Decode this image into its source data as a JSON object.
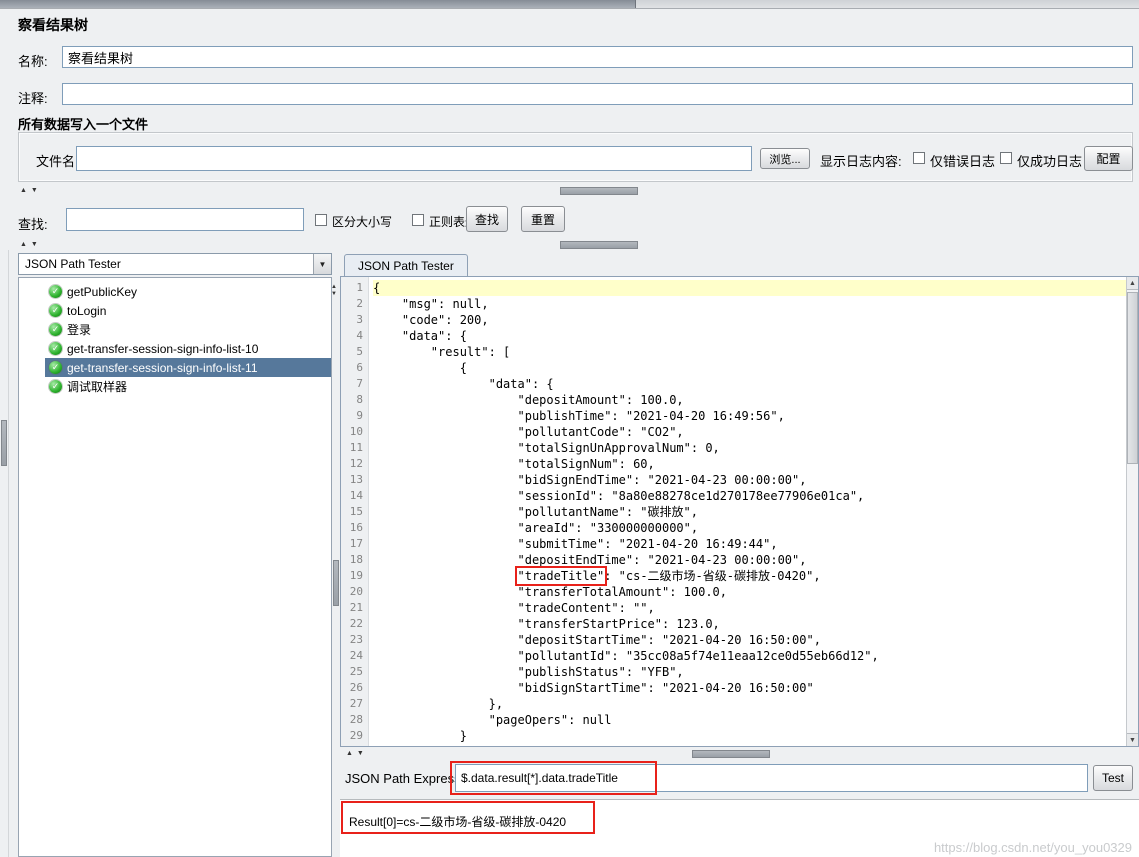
{
  "window": {
    "title": "察看结果树"
  },
  "name_row": {
    "label": "名称:",
    "value": "察看结果树"
  },
  "comments_row": {
    "label": "注释:",
    "value": ""
  },
  "file_panel": {
    "title": "所有数据写入一个文件",
    "filename_label": "文件名",
    "filename_value": "",
    "browse_button": "浏览...",
    "log_content_label": "显示日志内容:",
    "errors_only_label": "仅错误日志",
    "success_only_label": "仅成功日志",
    "configure_button": "配置"
  },
  "search_bar": {
    "label": "查找:",
    "value": "",
    "case_sensitive_label": "区分大小写",
    "regex_label": "正则表达式",
    "find_button": "查找",
    "reset_button": "重置"
  },
  "left_panel": {
    "renderer_selected": "JSON Path Tester",
    "tree_items": [
      {
        "label": "getPublicKey",
        "selected": false
      },
      {
        "label": "toLogin",
        "selected": false
      },
      {
        "label": "登录",
        "selected": false
      },
      {
        "label": "get-transfer-session-sign-info-list-10",
        "selected": false
      },
      {
        "label": "get-transfer-session-sign-info-list-11",
        "selected": true
      },
      {
        "label": "调试取样器",
        "selected": false
      }
    ]
  },
  "right_panel": {
    "tab_label": "JSON Path Tester",
    "expression_label": "JSON Path Expression",
    "expression_value": "$.data.result[*].data.tradeTitle",
    "test_button": "Test",
    "result_text": "Result[0]=cs-二级市场-省级-碳排放-0420"
  },
  "json_viewer": {
    "highlighted_line": 1,
    "boxed_line": 19,
    "boxed_token": "\"tradeTitle\"",
    "lines": [
      "{",
      "    \"msg\": null,",
      "    \"code\": 200,",
      "    \"data\": {",
      "        \"result\": [",
      "            {",
      "                \"data\": {",
      "                    \"depositAmount\": 100.0,",
      "                    \"publishTime\": \"2021-04-20 16:49:56\",",
      "                    \"pollutantCode\": \"CO2\",",
      "                    \"totalSignUnApprovalNum\": 0,",
      "                    \"totalSignNum\": 60,",
      "                    \"bidSignEndTime\": \"2021-04-23 00:00:00\",",
      "                    \"sessionId\": \"8a80e88278ce1d270178ee77906e01ca\",",
      "                    \"pollutantName\": \"碳排放\",",
      "                    \"areaId\": \"330000000000\",",
      "                    \"submitTime\": \"2021-04-20 16:49:44\",",
      "                    \"depositEndTime\": \"2021-04-23 00:00:00\",",
      "                    \"tradeTitle\": \"cs-二级市场-省级-碳排放-0420\",",
      "                    \"transferTotalAmount\": 100.0,",
      "                    \"tradeContent\": \"\",",
      "                    \"transferStartPrice\": 123.0,",
      "                    \"depositStartTime\": \"2021-04-20 16:50:00\",",
      "                    \"pollutantId\": \"35cc08a5f74e11eaa12ce0d55eb66d12\",",
      "                    \"publishStatus\": \"YFB\",",
      "                    \"bidSignStartTime\": \"2021-04-20 16:50:00\"",
      "                },",
      "                \"pageOpers\": null",
      "            }"
    ]
  },
  "watermark": "https://blog.csdn.net/you_you0329",
  "colors": {
    "selection_blue": "#56789b",
    "highlight_yellow": "#ffffca",
    "annotation_red": "#e8211a",
    "success_green": "#2db22d",
    "field_border_blue": "#7f9db9"
  }
}
